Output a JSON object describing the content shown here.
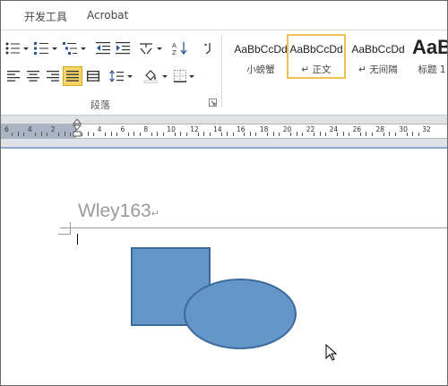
{
  "tabs": [
    {
      "label": "开发工具"
    },
    {
      "label": "Acrobat"
    }
  ],
  "ribbon": {
    "paragraph_group_label": "段落",
    "styles": [
      {
        "sample": "AaBbCcDd",
        "name": "小螃蟹"
      },
      {
        "sample": "AaBbCcDd",
        "name": "↵ 正文",
        "selected": true
      },
      {
        "sample": "AaBbCcDd",
        "name": "↵ 无间隔"
      },
      {
        "sample": "AaB",
        "name": "标题 1"
      }
    ]
  },
  "ruler": {
    "numbers": [
      "6",
      "4",
      "2",
      "2",
      "4",
      "6",
      "8",
      "10",
      "12",
      "14",
      "16",
      "18",
      "20",
      "22",
      "24",
      "26",
      "28",
      "30",
      "32"
    ]
  },
  "document": {
    "header_text": "Wley163",
    "paragraph_mark": "↵"
  },
  "colors": {
    "shape_fill": "#6496c8",
    "shape_border": "#3d6a9e",
    "selected_style_border": "#f0c050",
    "active_button": "#f5d46a"
  }
}
